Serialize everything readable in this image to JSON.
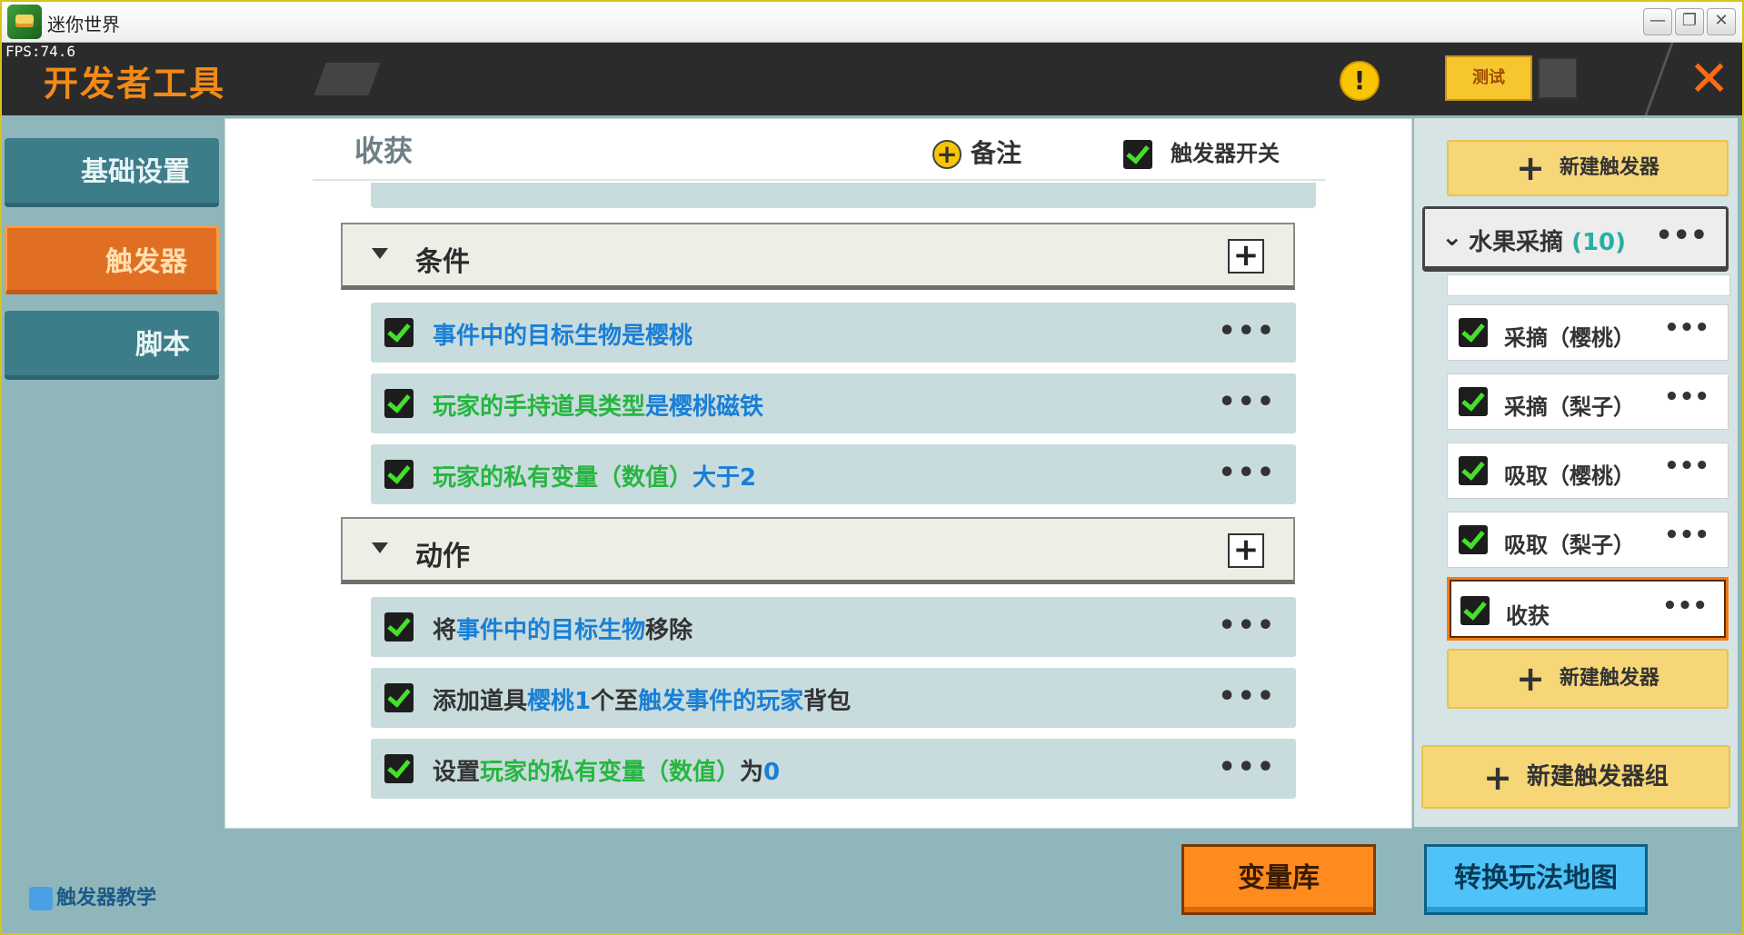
{
  "window": {
    "title": "迷你世界"
  },
  "header": {
    "fps": "FPS:74.6",
    "title": "开发者工具",
    "test_label": "测试",
    "warning_symbol": "!"
  },
  "nav": {
    "items": [
      {
        "label": "基础设置"
      },
      {
        "label": "触发器"
      },
      {
        "label": "脚本"
      }
    ],
    "tutorial": "触发器教学"
  },
  "main": {
    "title": "收获",
    "note_label": "备注",
    "switch_label": "触发器开关",
    "conditions_label": "条件",
    "actions_label": "动作",
    "conditions": [
      {
        "parts": [
          {
            "t": "事件中的目标生物是樱桃",
            "c": "b"
          }
        ]
      },
      {
        "parts": [
          {
            "t": "玩家的手持道具类型",
            "c": "g"
          },
          {
            "t": "是",
            "c": "b"
          },
          {
            "t": "樱桃磁铁",
            "c": "b"
          }
        ]
      },
      {
        "parts": [
          {
            "t": "玩家的私有变量（数值）",
            "c": "g"
          },
          {
            "t": "大于",
            "c": "b"
          },
          {
            "t": "2",
            "c": "b"
          }
        ]
      }
    ],
    "actions": [
      {
        "parts": [
          {
            "t": "将",
            "c": ""
          },
          {
            "t": "事件中的目标生物",
            "c": "b"
          },
          {
            "t": "移除",
            "c": ""
          }
        ]
      },
      {
        "parts": [
          {
            "t": "添加道具",
            "c": ""
          },
          {
            "t": "樱桃",
            "c": "b"
          },
          {
            "t": "1",
            "c": "b"
          },
          {
            "t": "个至",
            "c": ""
          },
          {
            "t": "触发事件的玩家",
            "c": "b"
          },
          {
            "t": "背包",
            "c": ""
          }
        ]
      },
      {
        "parts": [
          {
            "t": "设置",
            "c": ""
          },
          {
            "t": "玩家的私有变量（数值）",
            "c": "g"
          },
          {
            "t": "为",
            "c": ""
          },
          {
            "t": "0",
            "c": "b"
          }
        ]
      }
    ]
  },
  "sidebar": {
    "new_trigger": "新建触发器",
    "group_name": "水果采摘",
    "group_count": "(10)",
    "triggers": [
      {
        "label": "采摘（樱桃）"
      },
      {
        "label": "采摘（梨子）"
      },
      {
        "label": "吸取（樱桃）"
      },
      {
        "label": "吸取（梨子）"
      },
      {
        "label": "收获"
      }
    ],
    "new_group": "新建触发器组"
  },
  "bottom": {
    "variables": "变量库",
    "convert": "转换玩法地图"
  },
  "more_symbol": "•••"
}
